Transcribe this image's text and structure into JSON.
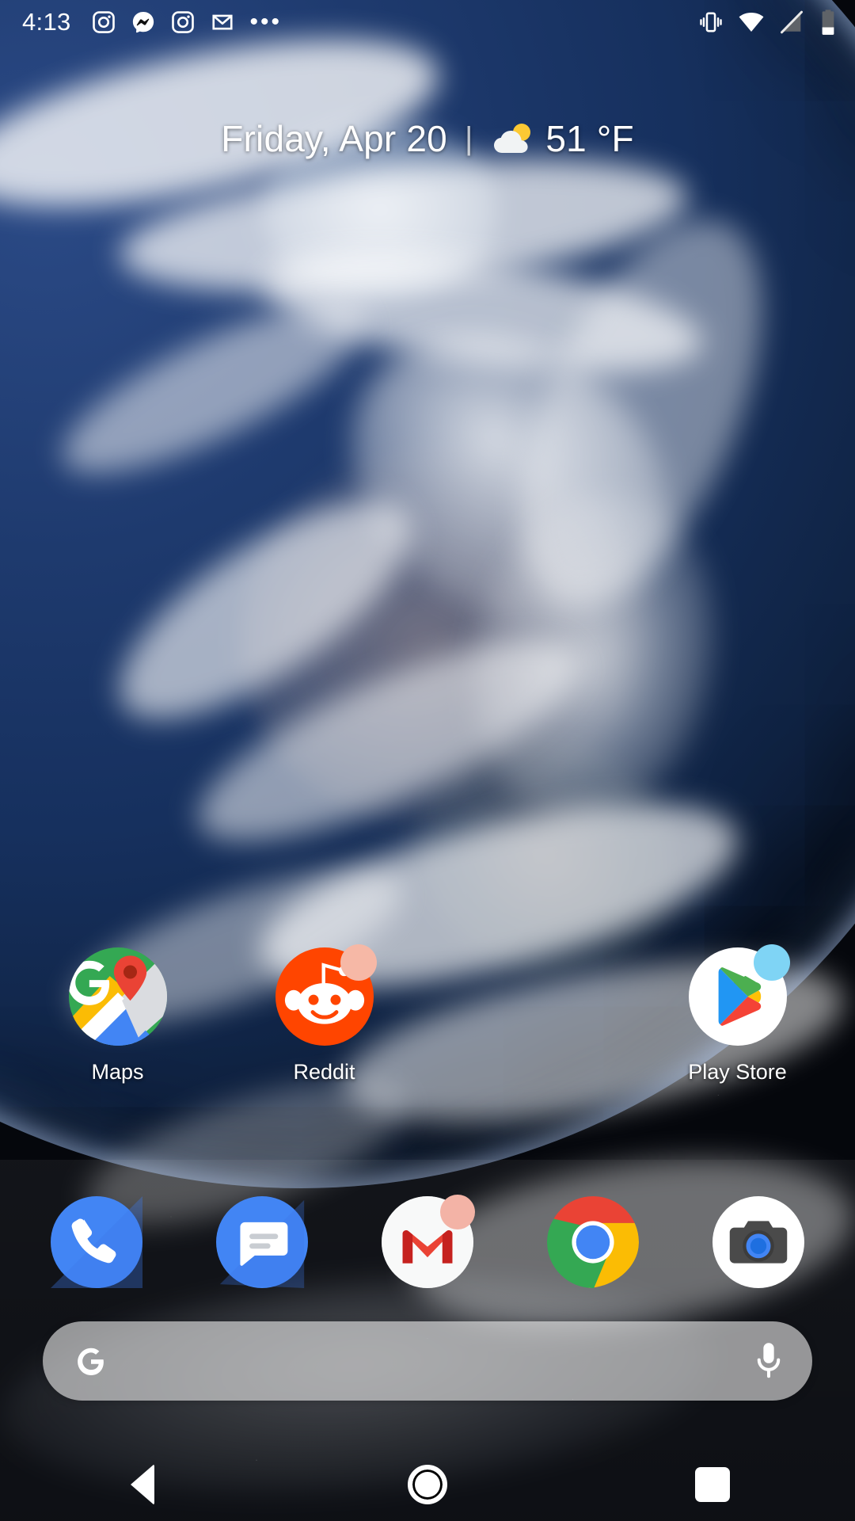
{
  "status_bar": {
    "clock": "4:13",
    "notification_icons": [
      "instagram-icon",
      "messenger-icon",
      "instagram-icon",
      "gmail-icon",
      "more-notifications-icon"
    ],
    "overflow_label": "•••",
    "system_icons": [
      "vibrate-icon",
      "wifi-icon",
      "signal-off-icon",
      "battery-icon"
    ],
    "battery_level_percent": 28,
    "wifi_full": true,
    "ringer_mode": "vibrate"
  },
  "widget": {
    "date": "Friday, Apr 20",
    "divider": "|",
    "weather_icon": "partly-cloudy-icon",
    "temperature": "51 °F"
  },
  "app_grid": {
    "rows": [
      [
        {
          "label": "Maps",
          "icon": "google-maps-icon",
          "badge": false
        },
        {
          "label": "Reddit",
          "icon": "reddit-icon",
          "badge": true,
          "badge_color": "#f6b8a6"
        },
        {
          "label": "",
          "icon": "empty-slot",
          "badge": false
        },
        {
          "label": "Play Store",
          "icon": "play-store-icon",
          "badge": true,
          "badge_color": "#7fd4f5"
        }
      ]
    ]
  },
  "dock": {
    "items": [
      {
        "label": "Phone",
        "icon": "phone-icon",
        "badge": false
      },
      {
        "label": "Messages",
        "icon": "messages-icon",
        "badge": false
      },
      {
        "label": "Gmail",
        "icon": "gmail-icon",
        "badge": true,
        "badge_color": "#f3b3a6"
      },
      {
        "label": "Chrome",
        "icon": "chrome-icon",
        "badge": false
      },
      {
        "label": "Camera",
        "icon": "camera-icon",
        "badge": false
      }
    ]
  },
  "search": {
    "logo": "google-g-icon",
    "placeholder": "",
    "value": "",
    "mic_icon": "microphone-icon"
  },
  "nav_bar": {
    "back_label": "Back",
    "home_label": "Home",
    "recents_label": "Recents",
    "icons": [
      "back-triangle-icon",
      "home-circle-icon",
      "recents-square-icon"
    ]
  },
  "colors": {
    "status_text": "#ffffff",
    "widget_text": "#ffffff",
    "search_pill": "#e8e8e8",
    "reddit_orange": "#ff4500",
    "gmail_red": "#d93025",
    "chrome_blue": "#4285f4",
    "maps_green": "#34a853",
    "phone_blue": "#4285f4"
  },
  "wallpaper": {
    "description": "earth-from-space-wallpaper"
  }
}
